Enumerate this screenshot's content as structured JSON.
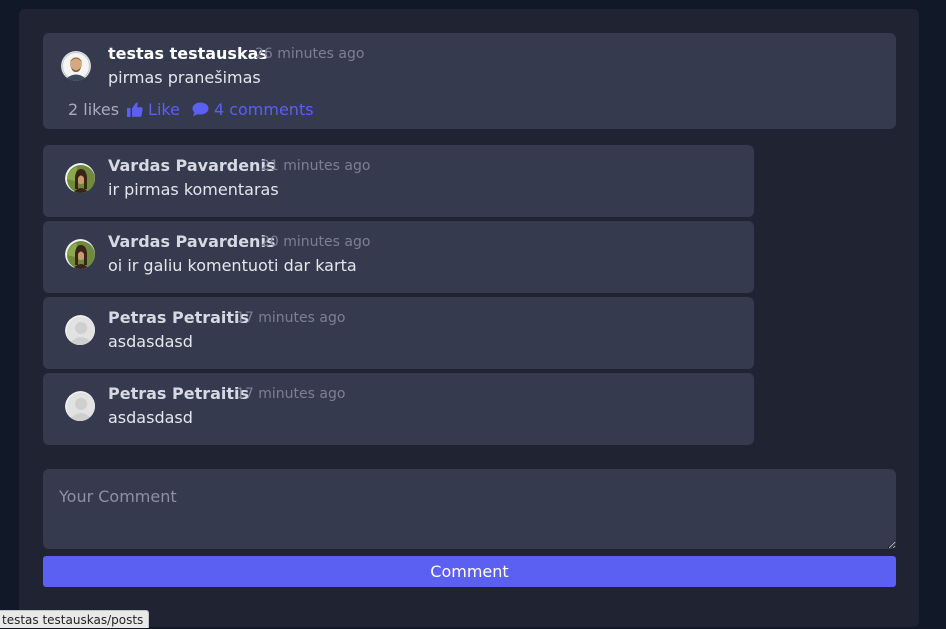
{
  "post": {
    "author": "testas testauskas",
    "time": "26 minutes ago",
    "text": "pirmas pranešimas",
    "likes_label": "2 likes",
    "like_label": "Like",
    "comments_label": "4 comments"
  },
  "comments": [
    {
      "author": "Vardas Pavardenis",
      "time": "21 minutes ago",
      "text": "ir pirmas komentaras",
      "avatar": "photo-avatar"
    },
    {
      "author": "Vardas Pavardenis",
      "time": "20 minutes ago",
      "text": "oi ir galiu komentuoti dar karta",
      "avatar": "photo-avatar"
    },
    {
      "author": "Petras Petraitis",
      "time": "17 minutes ago",
      "text": "asdasdasd",
      "avatar": "default-avatar"
    },
    {
      "author": "Petras Petraitis",
      "time": "17 minutes ago",
      "text": "asdasdasd",
      "avatar": "default-avatar"
    }
  ],
  "form": {
    "placeholder": "Your Comment",
    "value": "",
    "submit_label": "Comment"
  },
  "status_bar": {
    "url": "testas testauskas/posts"
  },
  "colors": {
    "background": "#111827",
    "panel": "#1f2332",
    "card": "#363a4f",
    "accent": "#5b5ff2",
    "muted": "#7d8094"
  },
  "icons": {
    "like": "thumbs-up-icon",
    "comments": "comment-bubble-icon"
  }
}
